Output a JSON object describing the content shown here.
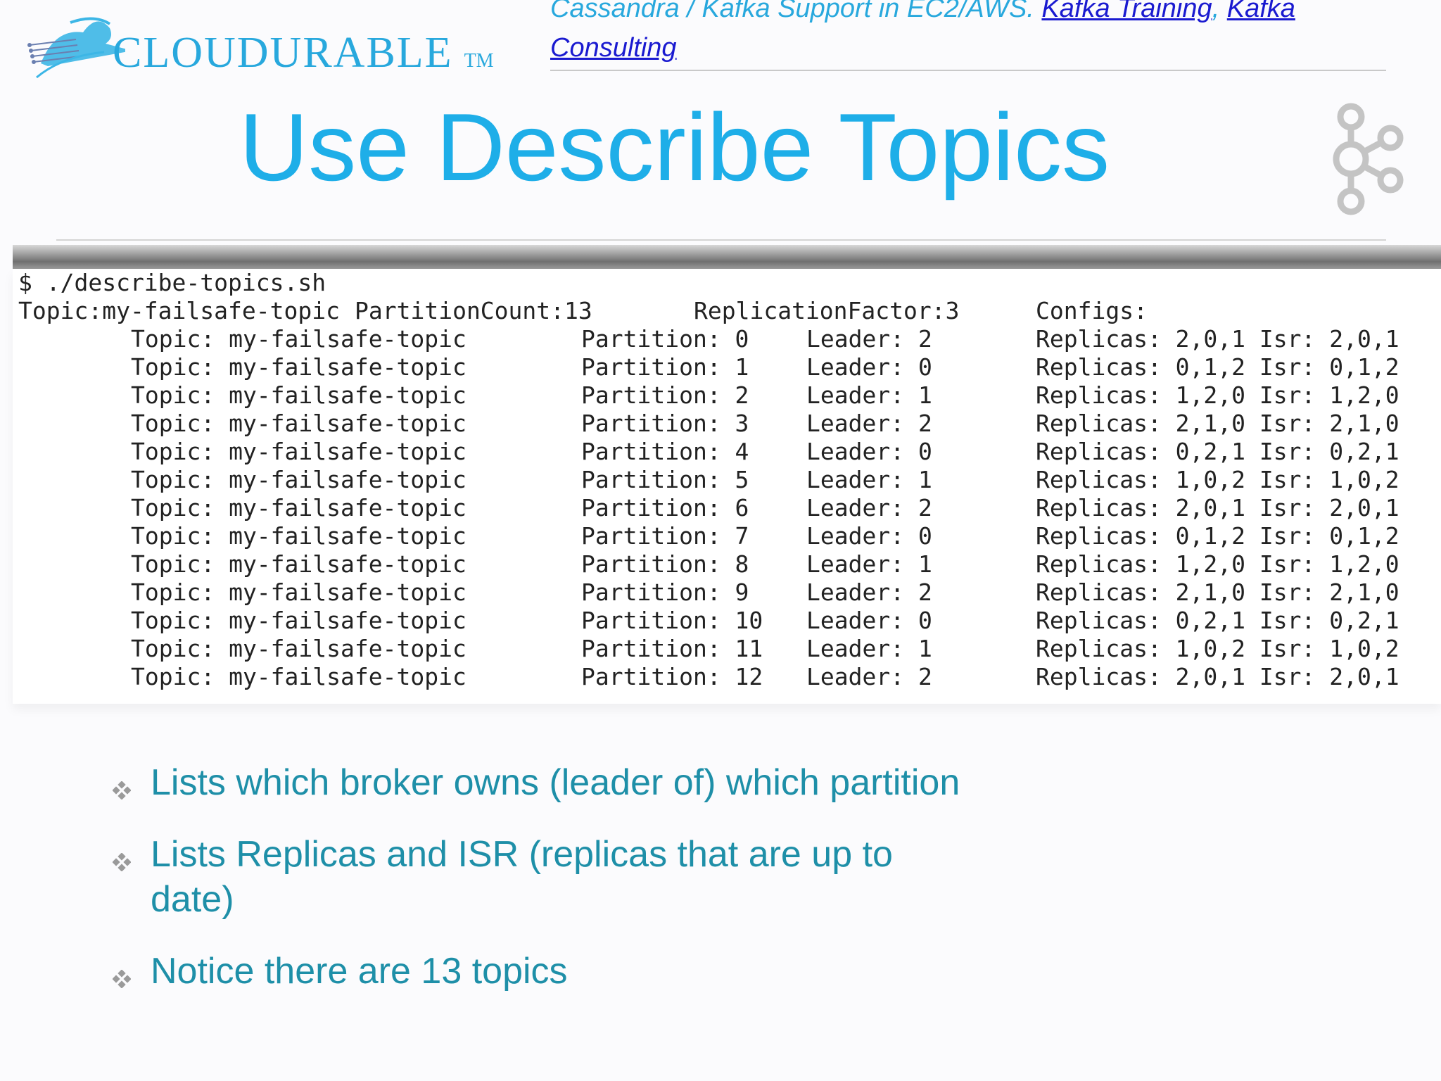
{
  "header": {
    "logo": {
      "name": "CLOUDURABLE",
      "tm": "TM"
    },
    "support_text": "Cassandra / Kafka Support in EC2/AWS. ",
    "link_training": "Kafka Training",
    "separator": ", ",
    "link_consulting": "Kafka Consulting"
  },
  "slide": {
    "title": "Use Describe Topics"
  },
  "terminal": {
    "command": "$ ./describe-topics.sh",
    "summary": {
      "topic": "Topic:my-failsafe-topic",
      "partition_count": "PartitionCount:13",
      "replication_factor": "ReplicationFactor:3",
      "configs": "Configs:"
    },
    "rows": [
      {
        "topic": "Topic: my-failsafe-topic",
        "partition": "Partition: 0",
        "leader": "Leader: 2",
        "replicas": "Replicas: 2,0,1 Isr: 2,0,1"
      },
      {
        "topic": "Topic: my-failsafe-topic",
        "partition": "Partition: 1",
        "leader": "Leader: 0",
        "replicas": "Replicas: 0,1,2 Isr: 0,1,2"
      },
      {
        "topic": "Topic: my-failsafe-topic",
        "partition": "Partition: 2",
        "leader": "Leader: 1",
        "replicas": "Replicas: 1,2,0 Isr: 1,2,0"
      },
      {
        "topic": "Topic: my-failsafe-topic",
        "partition": "Partition: 3",
        "leader": "Leader: 2",
        "replicas": "Replicas: 2,1,0 Isr: 2,1,0"
      },
      {
        "topic": "Topic: my-failsafe-topic",
        "partition": "Partition: 4",
        "leader": "Leader: 0",
        "replicas": "Replicas: 0,2,1 Isr: 0,2,1"
      },
      {
        "topic": "Topic: my-failsafe-topic",
        "partition": "Partition: 5",
        "leader": "Leader: 1",
        "replicas": "Replicas: 1,0,2 Isr: 1,0,2"
      },
      {
        "topic": "Topic: my-failsafe-topic",
        "partition": "Partition: 6",
        "leader": "Leader: 2",
        "replicas": "Replicas: 2,0,1 Isr: 2,0,1"
      },
      {
        "topic": "Topic: my-failsafe-topic",
        "partition": "Partition: 7",
        "leader": "Leader: 0",
        "replicas": "Replicas: 0,1,2 Isr: 0,1,2"
      },
      {
        "topic": "Topic: my-failsafe-topic",
        "partition": "Partition: 8",
        "leader": "Leader: 1",
        "replicas": "Replicas: 1,2,0 Isr: 1,2,0"
      },
      {
        "topic": "Topic: my-failsafe-topic",
        "partition": "Partition: 9",
        "leader": "Leader: 2",
        "replicas": "Replicas: 2,1,0 Isr: 2,1,0"
      },
      {
        "topic": "Topic: my-failsafe-topic",
        "partition": "Partition: 10",
        "leader": "Leader: 0",
        "replicas": "Replicas: 0,2,1 Isr: 0,2,1"
      },
      {
        "topic": "Topic: my-failsafe-topic",
        "partition": "Partition: 11",
        "leader": "Leader: 1",
        "replicas": "Replicas: 1,0,2 Isr: 1,0,2"
      },
      {
        "topic": "Topic: my-failsafe-topic",
        "partition": "Partition: 12",
        "leader": "Leader: 2",
        "replicas": "Replicas: 2,0,1 Isr: 2,0,1"
      }
    ]
  },
  "bullets": [
    "Lists which broker owns (leader of) which partition",
    "Lists Replicas and ISR (replicas that are up to date)",
    "Notice there are 13 topics"
  ],
  "colors": {
    "title": "#1eaee8",
    "bullet_text": "#1e8fa8",
    "link": "#1a1ad0",
    "logo": "#28a8dd",
    "kafka_logo": "#c4c4c4"
  },
  "icons": {
    "bullet": "diamond-bullet-icon",
    "kafka": "kafka-logo-icon",
    "logo": "cloud-logo-icon"
  }
}
